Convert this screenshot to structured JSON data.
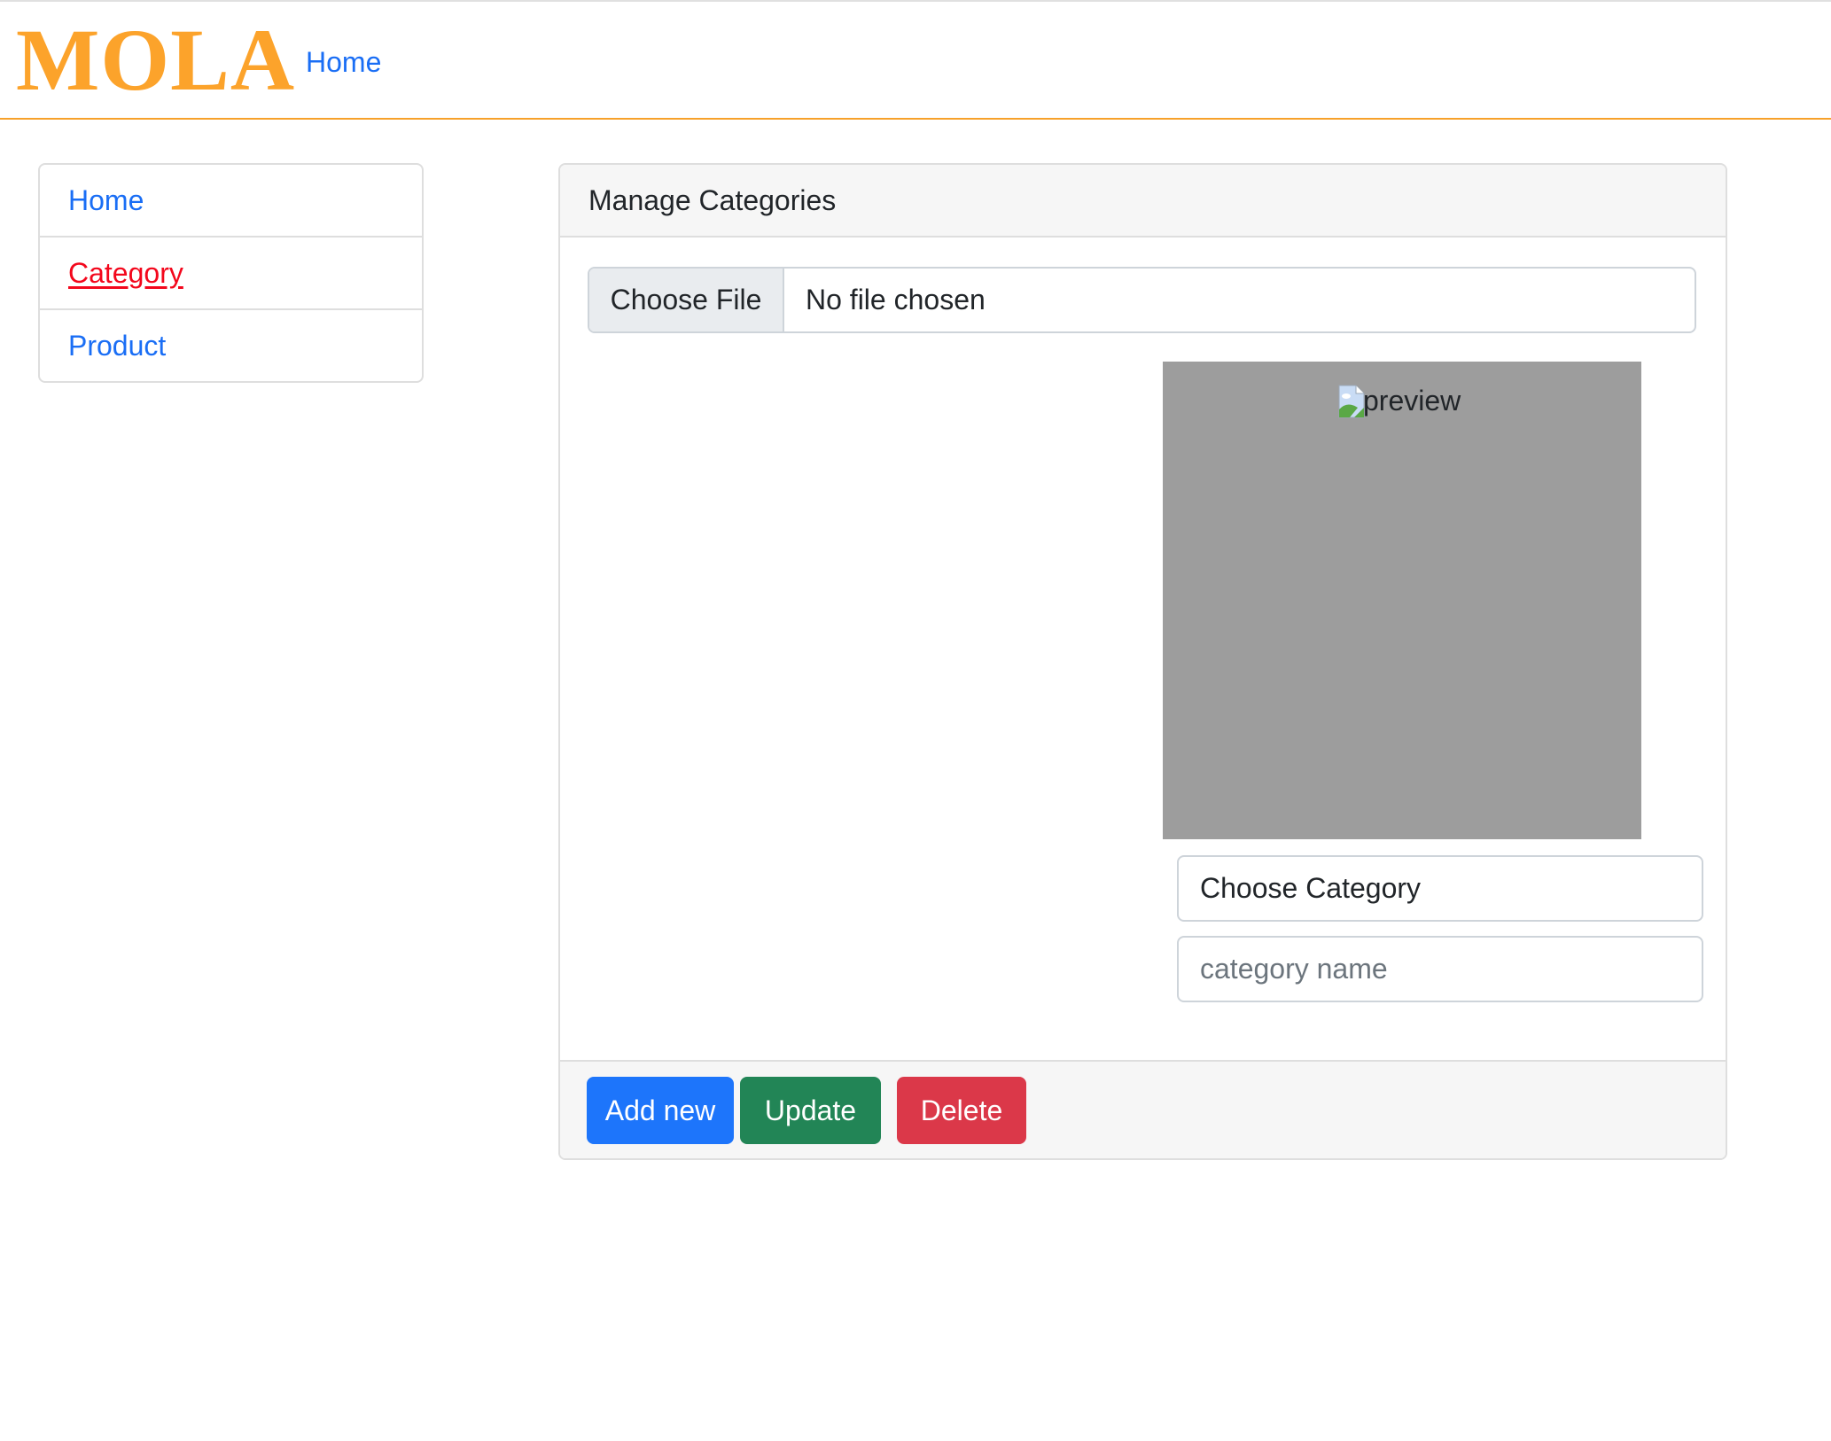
{
  "navbar": {
    "brand": "MOLA",
    "home_link": "Home",
    "brand_color": "#fca32b",
    "accent_line_color": "#f7a12a"
  },
  "sidebar": {
    "items": [
      {
        "label": "Home",
        "active": false
      },
      {
        "label": "Category",
        "active": true
      },
      {
        "label": "Product",
        "active": false
      }
    ]
  },
  "card": {
    "title": "Manage Categories",
    "file_input": {
      "button_label": "Choose File",
      "status": "No file chosen"
    },
    "preview": {
      "alt_text": "preview",
      "icon": "broken-image-icon"
    },
    "category_select": {
      "selected": "Choose Category"
    },
    "category_name_input": {
      "value": "",
      "placeholder": "category name"
    },
    "footer": {
      "add_label": "Add new",
      "update_label": "Update",
      "delete_label": "Delete"
    }
  },
  "colors": {
    "link": "#1a6ef5",
    "active_link": "#f3071c",
    "primary": "#1d75fb",
    "success": "#228556",
    "danger": "#db3849"
  }
}
